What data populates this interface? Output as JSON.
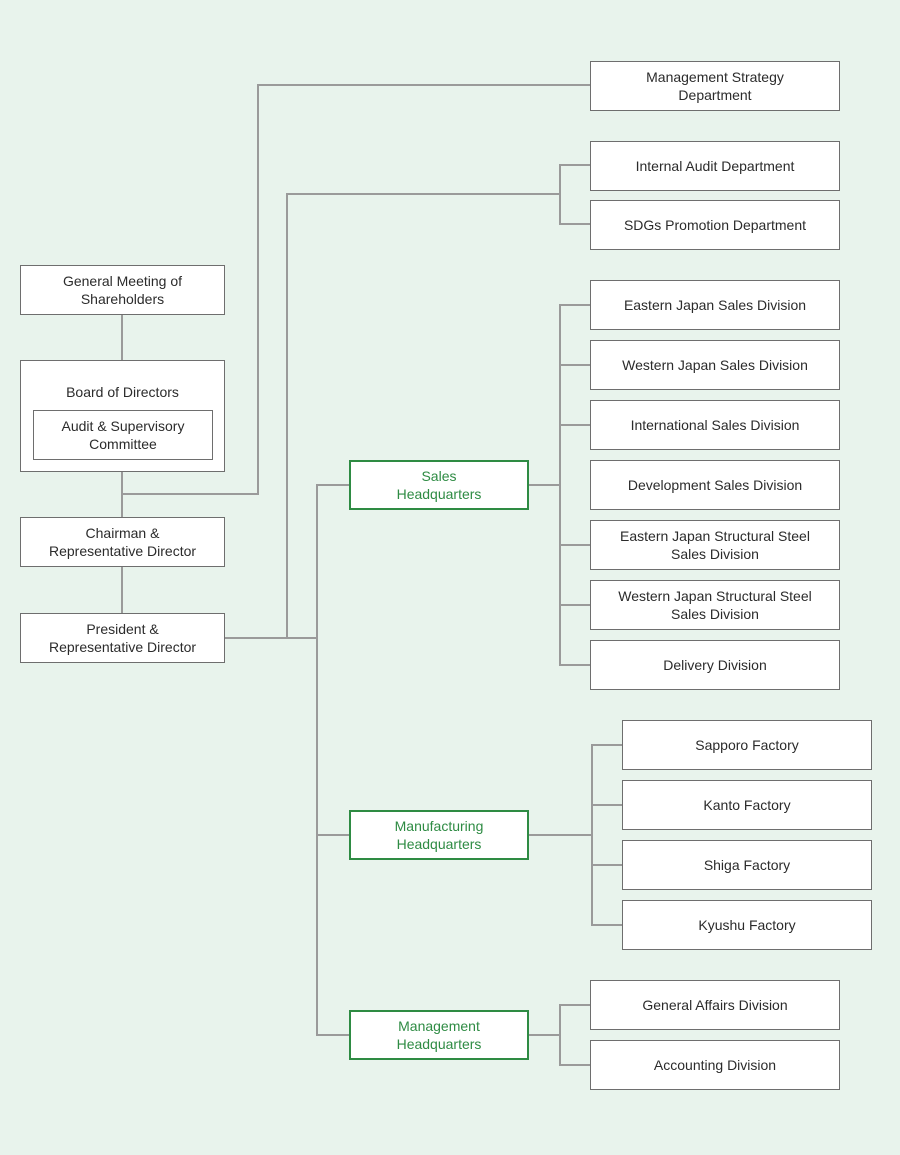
{
  "executive": {
    "shareholders": "General Meeting of\nShareholders",
    "board": "Board of Directors",
    "audit_committee": "Audit & Supervisory\nCommittee",
    "chairman": "Chairman &\nRepresentative Director",
    "president": "President &\nRepresentative Director"
  },
  "staff_departments": {
    "management_strategy": "Management Strategy\nDepartment",
    "internal_audit": "Internal Audit Department",
    "sdgs_promotion": "SDGs Promotion Department"
  },
  "headquarters": {
    "sales": {
      "label": "Sales\nHeadquarters",
      "divisions": [
        "Eastern Japan Sales Division",
        "Western Japan Sales Division",
        "International Sales Division",
        "Development Sales Division",
        "Eastern Japan Structural Steel\nSales Division",
        "Western Japan Structural Steel\nSales Division",
        "Delivery Division"
      ]
    },
    "manufacturing": {
      "label": "Manufacturing\nHeadquarters",
      "factories": [
        "Sapporo Factory",
        "Kanto Factory",
        "Shiga Factory",
        "Kyushu Factory"
      ]
    },
    "management": {
      "label": "Management\nHeadquarters",
      "divisions": [
        "General Affairs Division",
        "Accounting Division"
      ]
    }
  },
  "colors": {
    "background": "#e8f3ec",
    "headquarters_accent": "#2e8b43",
    "connector": "#9a9a9a"
  }
}
